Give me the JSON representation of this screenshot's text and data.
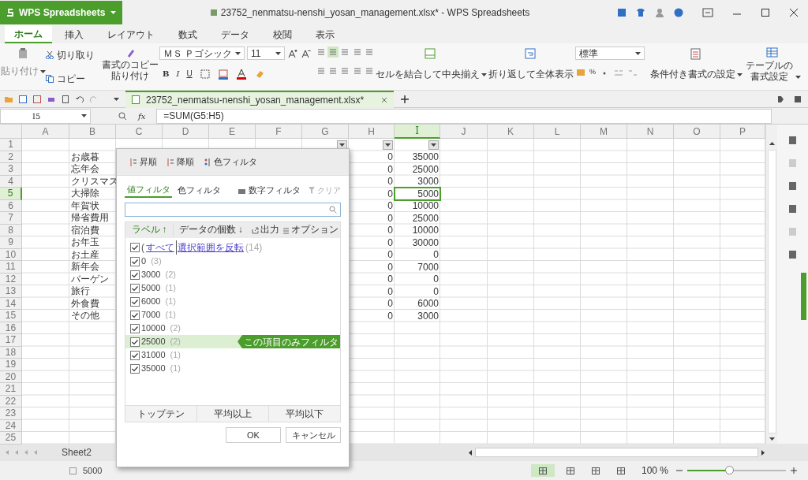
{
  "window": {
    "app_button": "WPS Spreadsheets",
    "title": "23752_nenmatsu-nenshi_yosan_management.xlsx* - WPS Spreadsheets"
  },
  "ribbon_tabs": [
    {
      "label": "ホーム",
      "selected": true
    },
    {
      "label": "挿入",
      "selected": false
    },
    {
      "label": "レイアウト",
      "selected": false
    },
    {
      "label": "数式",
      "selected": false
    },
    {
      "label": "データ",
      "selected": false
    },
    {
      "label": "校閲",
      "selected": false
    },
    {
      "label": "表示",
      "selected": false
    }
  ],
  "ribbon": {
    "paste": "貼り付け",
    "cut": "切り取り",
    "copy": "コピー",
    "format_painter": "書式のコピー貼り付け",
    "font": "ＭＳ Ｐゴシック",
    "font_size": "11",
    "bold": "B",
    "italic": "I",
    "underline": "U",
    "number_format": "標準",
    "percent": "%",
    "merge": "セルを結合して中央揃え",
    "wrap": "折り返して全体表示",
    "conditional": "条件付き書式の設定",
    "table_format": "テーブルの書式設定"
  },
  "doc_tab": {
    "title": "23752_nenmatsu-nenshi_yosan_management.xlsx*",
    "selected": true
  },
  "formula_bar": {
    "name_box": "I5",
    "fx": "fx",
    "formula": "=SUM(G5:H5)"
  },
  "columns": [
    {
      "label": "A",
      "selected": false,
      "filter": false
    },
    {
      "label": "B",
      "selected": false,
      "filter": false
    },
    {
      "label": "C",
      "selected": false,
      "filter": false
    },
    {
      "label": "D",
      "selected": false,
      "filter": false
    },
    {
      "label": "E",
      "selected": false,
      "filter": false
    },
    {
      "label": "F",
      "selected": false,
      "filter": false
    },
    {
      "label": "G",
      "selected": false,
      "filter": true
    },
    {
      "label": "H",
      "selected": false,
      "filter": true
    },
    {
      "label": "I",
      "selected": true,
      "filter": true
    },
    {
      "label": "J",
      "selected": false,
      "filter": false
    },
    {
      "label": "K",
      "selected": false,
      "filter": false
    },
    {
      "label": "L",
      "selected": false,
      "filter": false
    },
    {
      "label": "M",
      "selected": false,
      "filter": false
    },
    {
      "label": "N",
      "selected": false,
      "filter": false
    },
    {
      "label": "O",
      "selected": false,
      "filter": false
    },
    {
      "label": "P",
      "selected": false,
      "filter": false
    }
  ],
  "rows": [
    {
      "number": "1",
      "selected": false
    },
    {
      "number": "2",
      "selected": false,
      "b": "お歳暮",
      "h": "0",
      "i": "35000"
    },
    {
      "number": "3",
      "selected": false,
      "b": "忘年会",
      "h": "0",
      "i": "25000"
    },
    {
      "number": "4",
      "selected": false,
      "b": "クリスマス",
      "h": "0",
      "i": "3000"
    },
    {
      "number": "5",
      "selected": true,
      "b": "大掃除",
      "h": "0",
      "i": "5000"
    },
    {
      "number": "6",
      "selected": false,
      "b": "年賀状",
      "h": "0",
      "i": "10000"
    },
    {
      "number": "7",
      "selected": false,
      "b": "帰省費用",
      "h": "0",
      "i": "25000"
    },
    {
      "number": "8",
      "selected": false,
      "b": "宿泊費",
      "h": "0",
      "i": "10000"
    },
    {
      "number": "9",
      "selected": false,
      "b": "お年玉",
      "h": "0",
      "i": "30000"
    },
    {
      "number": "10",
      "selected": false,
      "b": "お土産",
      "h": "0",
      "i": "0"
    },
    {
      "number": "11",
      "selected": false,
      "b": "新年会",
      "h": "0",
      "i": "7000"
    },
    {
      "number": "12",
      "selected": false,
      "b": "バーゲン",
      "h": "0",
      "i": "0"
    },
    {
      "number": "13",
      "selected": false,
      "b": "旅行",
      "h": "0",
      "i": "0"
    },
    {
      "number": "14",
      "selected": false,
      "b": "外食費",
      "h": "0",
      "i": "6000"
    },
    {
      "number": "15",
      "selected": false,
      "b": "その他",
      "h": "0",
      "i": "3000"
    },
    {
      "number": "16",
      "selected": false
    },
    {
      "number": "17",
      "selected": false
    },
    {
      "number": "18",
      "selected": false
    },
    {
      "number": "19",
      "selected": false
    },
    {
      "number": "20",
      "selected": false
    },
    {
      "number": "21",
      "selected": false
    },
    {
      "number": "22",
      "selected": false
    },
    {
      "number": "23",
      "selected": false
    },
    {
      "number": "24",
      "selected": false
    },
    {
      "number": "25",
      "selected": false
    }
  ],
  "filter_dialog": {
    "sort": [
      "昇順",
      "降順",
      "色フィルタ"
    ],
    "tabs": [
      {
        "label": "値フィルタ",
        "selected": true
      },
      {
        "label": "色フィルタ",
        "selected": false
      }
    ],
    "number_filter": "数字フィルタ",
    "clear": {
      "label": "クリア",
      "disabled": true
    },
    "list_header": {
      "label": "ラベル ↑",
      "count": "データの個数 ↓",
      "export": "出力",
      "options": "オプション"
    },
    "all_item": {
      "open": "(",
      "select_all": "すべて",
      "invert": "選択範囲を反転",
      "count": "(14)",
      "checked": true
    },
    "only_this_label": "この項目のみフィルタ",
    "items": [
      {
        "label": "0",
        "count": "(3)",
        "checked": true,
        "highlighted": false
      },
      {
        "label": "3000",
        "count": "(2)",
        "checked": true,
        "highlighted": false
      },
      {
        "label": "5000",
        "count": "(1)",
        "checked": true,
        "highlighted": false
      },
      {
        "label": "6000",
        "count": "(1)",
        "checked": true,
        "highlighted": false
      },
      {
        "label": "7000",
        "count": "(1)",
        "checked": true,
        "highlighted": false
      },
      {
        "label": "10000",
        "count": "(2)",
        "checked": true,
        "highlighted": false
      },
      {
        "label": "25000",
        "count": "(2)",
        "checked": true,
        "highlighted": true
      },
      {
        "label": "31000",
        "count": "(1)",
        "checked": true,
        "highlighted": false
      },
      {
        "label": "35000",
        "count": "(1)",
        "checked": true,
        "highlighted": false
      }
    ],
    "quick_buttons": [
      "トップテン",
      "平均以上",
      "平均以下"
    ],
    "ok": "OK",
    "cancel": "キャンセル"
  },
  "sheet_tabs": [
    {
      "label": "Sheet2",
      "selected": false
    }
  ],
  "status_bar": {
    "sum": "5000",
    "zoom": "100 %",
    "zoom_level": {
      "level": 0.42
    },
    "views": [
      {
        "selected": true
      },
      {
        "selected": false
      },
      {
        "selected": false
      },
      {
        "selected": false
      }
    ]
  }
}
